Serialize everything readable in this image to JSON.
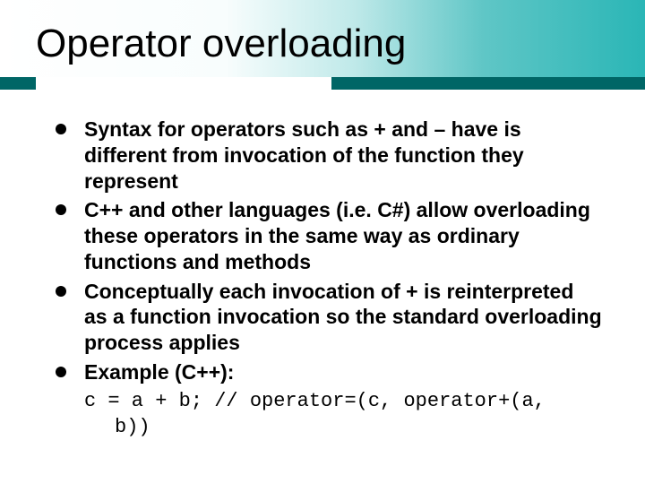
{
  "title": "Operator overloading",
  "bullets": {
    "b1": "Syntax for operators such as + and – have is different from invocation of the function they represent",
    "b2": "C++ and other languages (i.e. C#) allow overloading these operators in the same way as ordinary functions and methods",
    "b3": "Conceptually each invocation of + is reinterpreted as a function invocation so the standard overloading process applies",
    "b4": "Example (C++):"
  },
  "code": {
    "line1": "c = a + b; // operator=(c, operator+(a,",
    "line2": "b))"
  }
}
